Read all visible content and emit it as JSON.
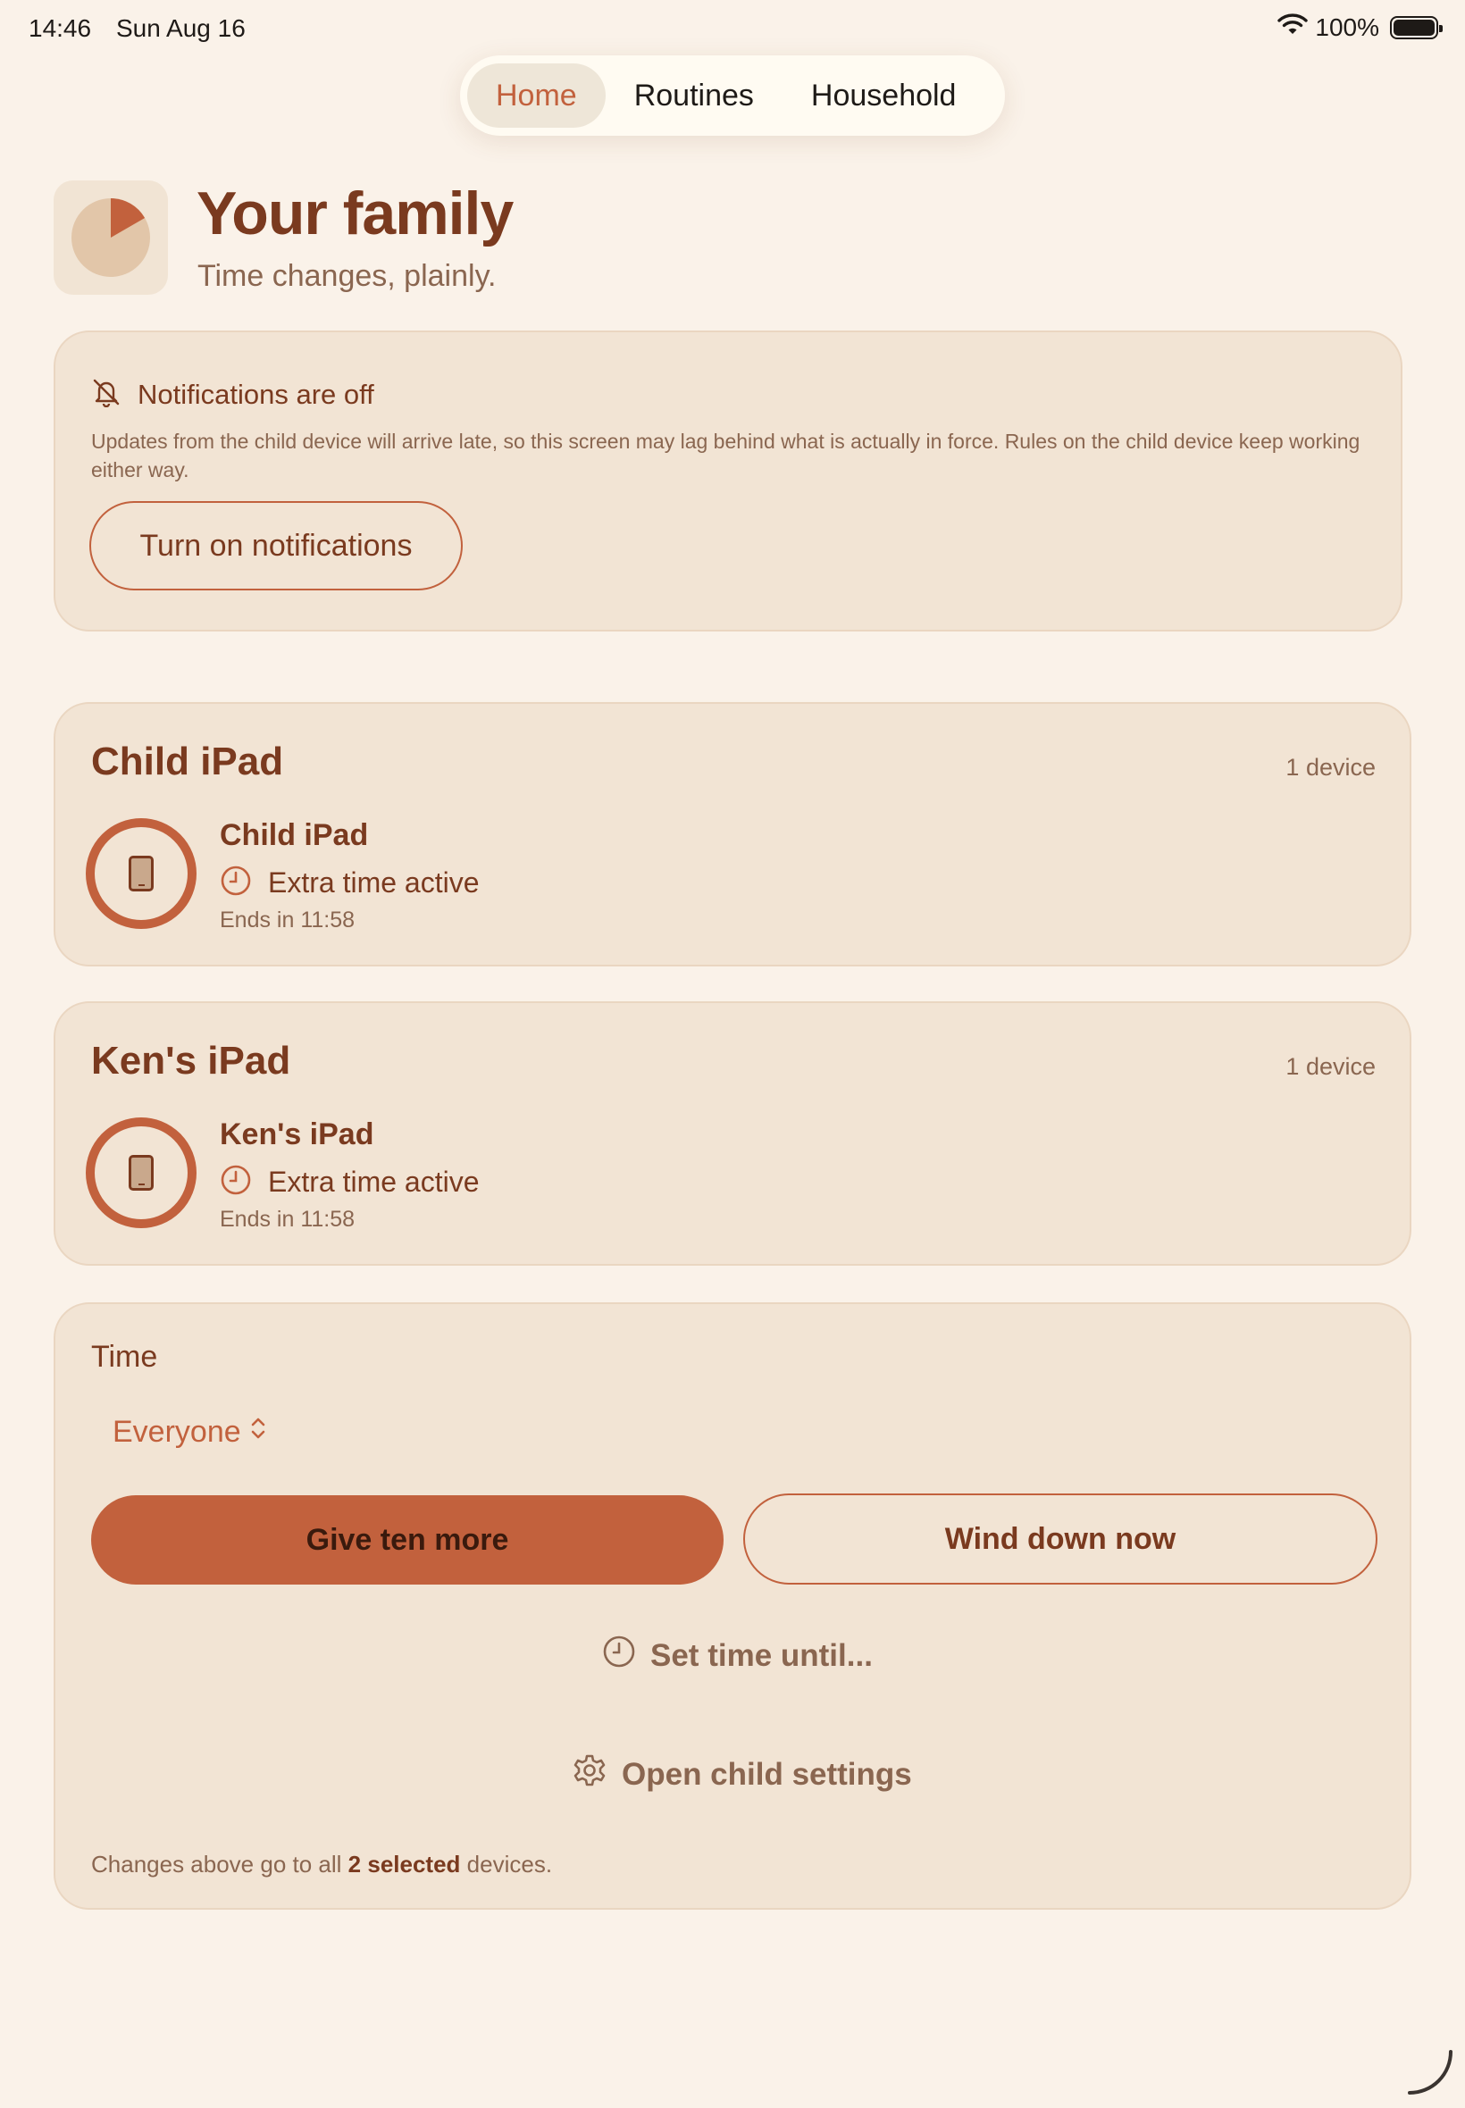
{
  "status_bar": {
    "time": "14:46",
    "date": "Sun Aug 16",
    "battery": "100%"
  },
  "tabs": [
    {
      "label": "Home",
      "active": true
    },
    {
      "label": "Routines",
      "active": false
    },
    {
      "label": "Household",
      "active": false
    }
  ],
  "header": {
    "title": "Your family",
    "subtitle": "Time changes, plainly."
  },
  "notifications": {
    "title": "Notifications are off",
    "body": "Updates from the child device will arrive late, so this screen may lag behind what is actually in force. Rules on the child device keep working either way.",
    "button": "Turn on notifications"
  },
  "groups": [
    {
      "title": "Child iPad",
      "count": "1 device",
      "device": {
        "name": "Child iPad",
        "status": "Extra time active",
        "ends_label": "Ends in",
        "ends_time": "11:58"
      }
    },
    {
      "title": "Ken's iPad",
      "count": "1 device",
      "device": {
        "name": "Ken's iPad",
        "status": "Extra time active",
        "ends_label": "Ends in",
        "ends_time": "11:58"
      }
    }
  ],
  "time_panel": {
    "title": "Time",
    "scope": "Everyone",
    "primary_button": "Give ten more",
    "secondary_button": "Wind down now",
    "set_time_link": "Set time until...",
    "settings_link": "Open child settings",
    "note_prefix": "Changes above go to all",
    "note_count": "2 selected",
    "note_suffix": "devices."
  },
  "colors": {
    "background": "#FAF2E9",
    "card": "#F2E4D4",
    "accent": "#C2613D",
    "title_text": "#7A3A1F",
    "muted_text": "#8A6650"
  }
}
